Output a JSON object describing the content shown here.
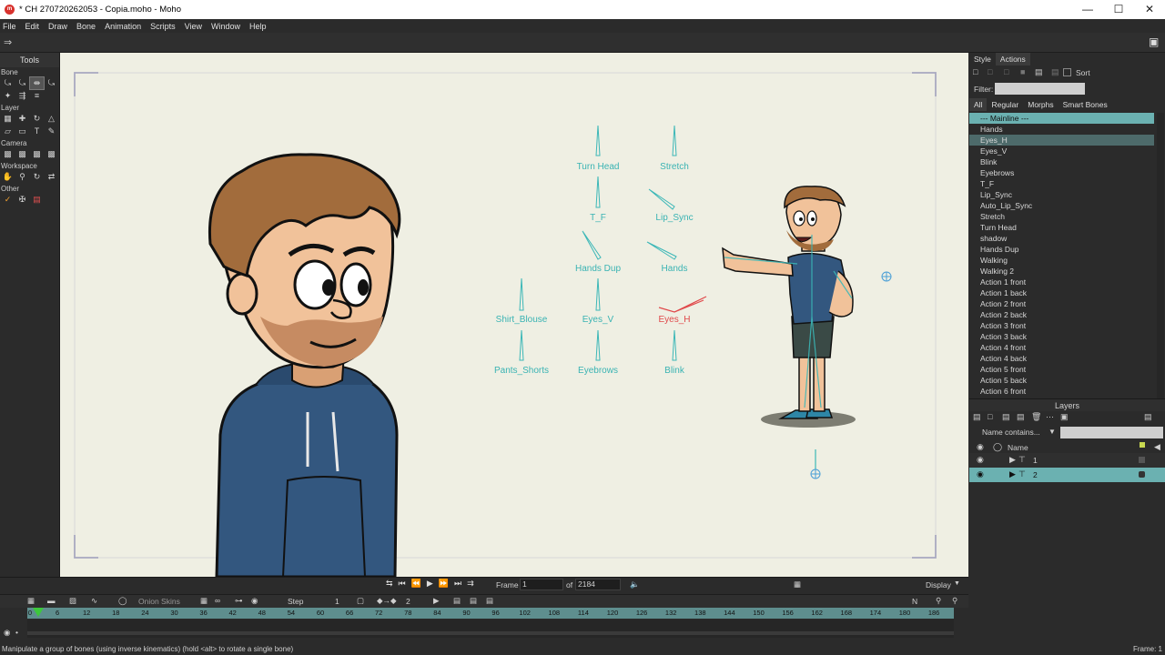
{
  "window": {
    "title": "* CH 270720262053 - Copia.moho - Moho",
    "app_icon": "moho-app-icon"
  },
  "menu": [
    "File",
    "Edit",
    "Draw",
    "Bone",
    "Animation",
    "Scripts",
    "View",
    "Window",
    "Help"
  ],
  "tools": {
    "title": "Tools",
    "sections": [
      "Bone",
      "Layer",
      "Camera",
      "Workspace",
      "Other"
    ]
  },
  "canvas": {
    "background": "#efefe3",
    "bone_labels": [
      "Turn Head",
      "Stretch",
      "T_F",
      "Lip_Sync",
      "Hands Dup",
      "Hands",
      "Shirt_Blouse",
      "Eyes_V",
      "Eyes_H",
      "Pants_Shorts",
      "Eyebrows",
      "Blink"
    ],
    "selected_bone": "Eyes_H",
    "bone_color": "#39b3b3",
    "selected_color": "#e0484a"
  },
  "right_panel": {
    "tabs": [
      "Style",
      "Actions"
    ],
    "sort_label": "Sort",
    "filter_label": "Filter:",
    "filter_value": "",
    "subtabs": [
      "All",
      "Regular",
      "Morphs",
      "Smart Bones"
    ],
    "actions": [
      "--- Mainline ---",
      "Hands",
      "Eyes_H",
      "Eyes_V",
      "Blink",
      "Eyebrows",
      "T_F",
      "Lip_Sync",
      "Auto_Lip_Sync",
      "Stretch",
      "Turn Head",
      "shadow",
      "Hands Dup",
      "Walking",
      "Walking 2",
      "Action 1 front",
      "Action 1 back",
      "Action 2 front",
      "Action 2 back",
      "Action 3 front",
      "Action 3 back",
      "Action 4 front",
      "Action 4 back",
      "Action 5 front",
      "Action 5 back",
      "Action 6 front"
    ],
    "selected_action": "Eyes_H",
    "layers_title": "Layers",
    "layer_filter": "Name contains...",
    "name_col": "Name",
    "layers": [
      "1",
      "2"
    ],
    "selected_layer": "2"
  },
  "timeline": {
    "frame_label": "Frame",
    "frame_value": "1",
    "of_label": "of",
    "total_frames": "2184",
    "display_label": "Display",
    "onion_label": "Onion Skins",
    "interp_label": "Step",
    "interp_count": "1",
    "keys_count": "2",
    "n_label": "N",
    "ruler_ticks": [
      "0",
      "6",
      "12",
      "18",
      "24",
      "30",
      "36",
      "42",
      "48",
      "54",
      "60",
      "66",
      "72",
      "78",
      "84",
      "90",
      "96",
      "102",
      "108",
      "114",
      "120",
      "126",
      "132",
      "138",
      "144",
      "150",
      "156",
      "162",
      "168",
      "174",
      "180",
      "186"
    ]
  },
  "status": {
    "message": "Manipulate a group of bones (using inverse kinematics) (hold <alt> to rotate a single bone)",
    "frame_right": "Frame: 1"
  }
}
